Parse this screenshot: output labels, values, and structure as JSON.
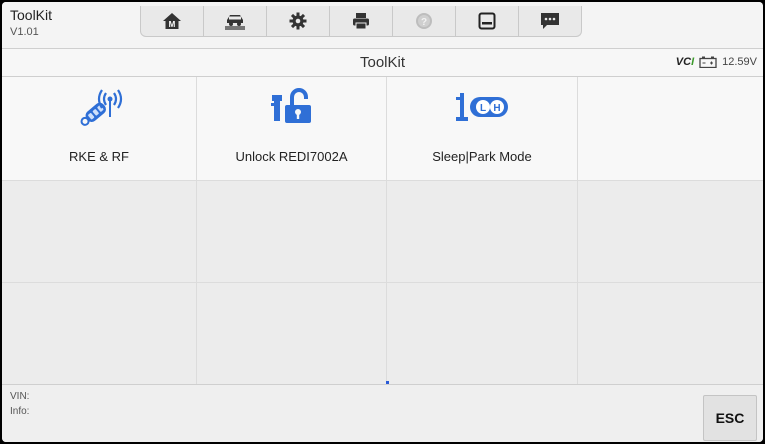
{
  "app": {
    "name": "ToolKit",
    "version": "V1.01"
  },
  "toolbar": {
    "buttons": [
      {
        "icon": "home-icon"
      },
      {
        "icon": "vehicle-lift-icon"
      },
      {
        "icon": "gear-icon"
      },
      {
        "icon": "printer-icon"
      },
      {
        "icon": "help-icon"
      },
      {
        "icon": "save-icon"
      },
      {
        "icon": "message-icon"
      }
    ]
  },
  "titlebar": {
    "title": "ToolKit",
    "vci_label": "VC",
    "vci_suffix": "I",
    "battery_voltage": "12.59V"
  },
  "tiles": [
    {
      "label": "RKE & RF",
      "icon": "key-fob-signal-icon"
    },
    {
      "label": "Unlock REDI7002A",
      "icon": "unlock-icon"
    },
    {
      "label": "Sleep|Park Mode",
      "icon": "sleep-park-icon"
    }
  ],
  "bottombar": {
    "vin_label": "VIN:",
    "info_label": "Info:",
    "esc_label": "ESC"
  }
}
